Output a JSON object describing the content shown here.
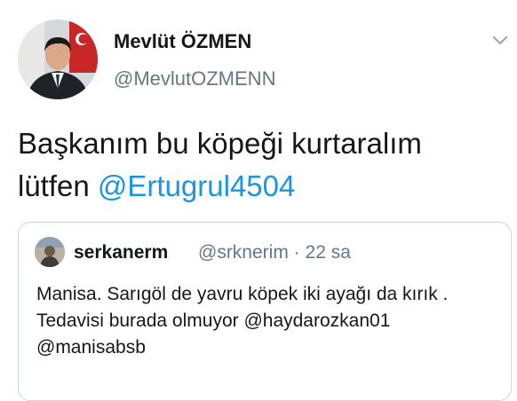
{
  "tweet": {
    "author_name": "Mevlüt ÖZMEN",
    "author_handle": "@MevlutOZMENN",
    "text_main": "Başkanım bu köpeği kurtaralım lütfen ",
    "text_mention": "@Ertugrul4504"
  },
  "quoted_tweet": {
    "author_name": "serkanerm",
    "author_handle": "@srknerim",
    "separator": "·",
    "time": "22 sa",
    "text": "Manisa. Sarıgöl de yavru köpek iki ayağı da kırık . Tedavisi burada olmuyor @haydarozkan01 @manisabsb"
  },
  "icons": {
    "menu": "chevron-down-icon"
  },
  "colors": {
    "link": "#1b95e0",
    "secondary_text": "#657786",
    "border": "#ccd6dd"
  }
}
